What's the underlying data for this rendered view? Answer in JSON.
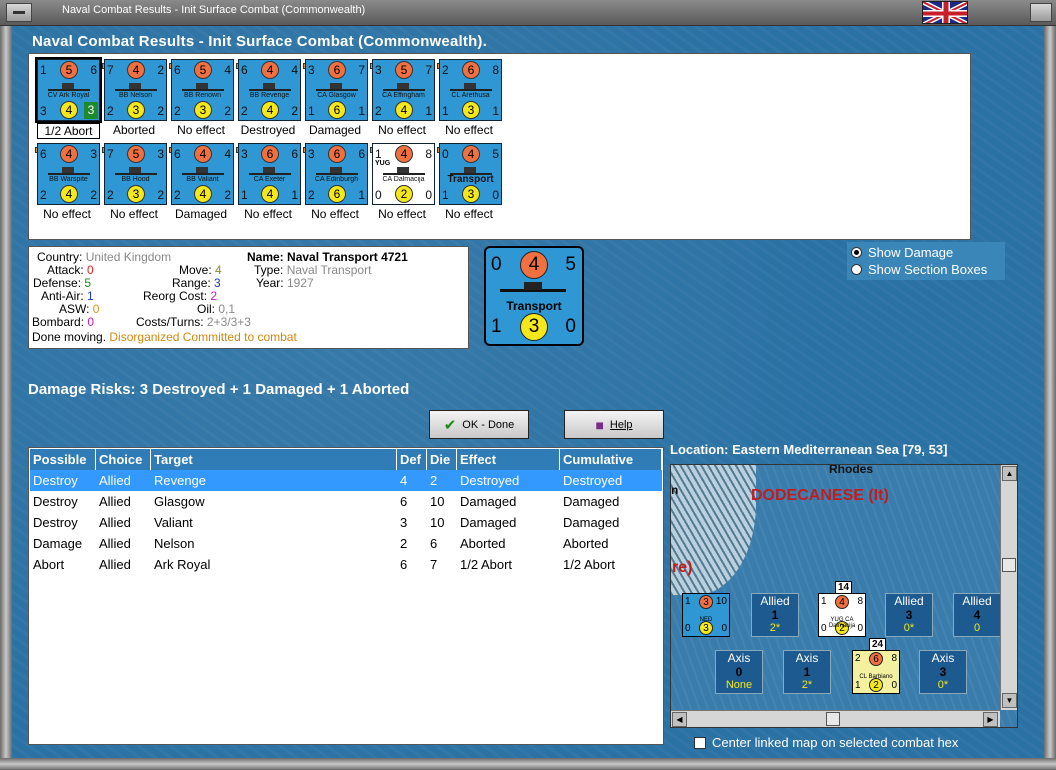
{
  "window": {
    "title": "Naval Combat Results - Init Surface Combat (Commonwealth)"
  },
  "heading": "Naval Combat Results - Init Surface Combat (Commonwealth).",
  "units": [
    {
      "tl": "1",
      "tc": "5",
      "tr": "6",
      "bl": "3",
      "bc": "4",
      "br": "3",
      "name": "CV Ark Royal",
      "result": "1/2 Abort",
      "selected": true,
      "green": true
    },
    {
      "tl": "7",
      "tc": "4",
      "tr": "2",
      "bl": "2",
      "bc": "3",
      "br": "2",
      "name": "BB Nelson",
      "result": "Aborted"
    },
    {
      "tl": "6",
      "tc": "5",
      "tr": "4",
      "bl": "2",
      "bc": "3",
      "br": "2",
      "name": "BB Renown",
      "result": "No effect"
    },
    {
      "tl": "6",
      "tc": "4",
      "tr": "4",
      "bl": "2",
      "bc": "4",
      "br": "2",
      "name": "BB Revenge",
      "result": "Destroyed"
    },
    {
      "tl": "3",
      "tc": "6",
      "tr": "7",
      "bl": "1",
      "bc": "6",
      "br": "1",
      "name": "CA Glasgow",
      "result": "Damaged"
    },
    {
      "tl": "3",
      "tc": "5",
      "tr": "7",
      "bl": "2",
      "bc": "4",
      "br": "1",
      "name": "CA Effingham",
      "result": "No effect"
    },
    {
      "tl": "2",
      "tc": "6",
      "tr": "8",
      "bl": "1",
      "bc": "3",
      "br": "1",
      "name": "CL Arethusa",
      "result": "No effect"
    },
    {
      "tl": "6",
      "tc": "4",
      "tr": "3",
      "bl": "2",
      "bc": "4",
      "br": "2",
      "name": "BB Warspite",
      "result": "No effect"
    },
    {
      "tl": "7",
      "tc": "5",
      "tr": "3",
      "bl": "2",
      "bc": "3",
      "br": "2",
      "name": "BB Hood",
      "result": "No effect"
    },
    {
      "tl": "6",
      "tc": "4",
      "tr": "4",
      "bl": "2",
      "bc": "4",
      "br": "2",
      "name": "BB Valiant",
      "result": "Damaged"
    },
    {
      "tl": "3",
      "tc": "6",
      "tr": "6",
      "bl": "1",
      "bc": "4",
      "br": "1",
      "name": "CA Exeter",
      "result": "No effect"
    },
    {
      "tl": "3",
      "tc": "6",
      "tr": "6",
      "bl": "2",
      "bc": "6",
      "br": "1",
      "name": "CA Edinburgh",
      "result": "No effect"
    },
    {
      "tl": "1",
      "tc": "4",
      "tr": "8",
      "bl": "0",
      "bc": "2",
      "br": "0",
      "name": "CA Dalmacija",
      "nat": "YUG",
      "result": "No effect",
      "white": true
    },
    {
      "tl": "0",
      "tc": "4",
      "tr": "5",
      "bl": "1",
      "bc": "3",
      "br": "0",
      "name": "Transport",
      "result": "No effect",
      "big": true
    }
  ],
  "info": {
    "country_label": "Country:",
    "country": "United Kingdom",
    "attack_label": "Attack:",
    "attack": "0",
    "defense_label": "Defense:",
    "defense": "5",
    "antiair_label": "Anti-Air:",
    "antiair": "1",
    "asw_label": "ASW:",
    "asw": "0",
    "bombard_label": "Bombard:",
    "bombard": "0",
    "name_label": "Name:",
    "name": "Naval Transport 4721",
    "type_label": "Type:",
    "type": "Naval Transport",
    "year_label": "Year:",
    "year": "1927",
    "move_label": "Move:",
    "move": "4",
    "range_label": "Range:",
    "range": "3",
    "reorg_label": "Reorg Cost:",
    "reorg": "2",
    "oil_label": "Oil:",
    "oil": "0,1",
    "costs_label": "Costs/Turns:",
    "costs": "2+3/3+3",
    "status_label": "Done moving.",
    "status": "Disorganized Committed to combat"
  },
  "big_counter": {
    "tl": "0",
    "tc": "4",
    "tr": "5",
    "bl": "1",
    "bc": "3",
    "br": "0",
    "name": "Transport"
  },
  "radio": {
    "show_damage": "Show Damage",
    "show_sections": "Show Section Boxes"
  },
  "damage_risks": "Damage Risks: 3 Destroyed + 1 Damaged + 1 Aborted",
  "buttons": {
    "ok": "OK - Done",
    "help": "Help"
  },
  "table": {
    "headers": [
      "Possible",
      "Choice",
      "Target",
      "Def",
      "Die",
      "Effect",
      "Cumulative"
    ],
    "rows": [
      [
        "Destroy",
        "Allied",
        "Revenge",
        "4",
        "2",
        "Destroyed",
        "Destroyed"
      ],
      [
        "Destroy",
        "Allied",
        "Glasgow",
        "6",
        "10",
        "Damaged",
        "Damaged"
      ],
      [
        "Destroy",
        "Allied",
        "Valiant",
        "3",
        "10",
        "Damaged",
        "Damaged"
      ],
      [
        "Damage",
        "Allied",
        "Nelson",
        "2",
        "6",
        "Aborted",
        "Aborted"
      ],
      [
        "Abort",
        "Allied",
        "Ark Royal",
        "6",
        "7",
        "1/2 Abort",
        "1/2 Abort"
      ]
    ]
  },
  "map": {
    "location": "Location:  Eastern Mediterranean Sea [79, 53]",
    "label_rhodes": "Rhodes",
    "label_dodecanese": "DODECANESE (It)",
    "label_re": "re)",
    "label_n": "n",
    "stack1": "14",
    "stack2": "24",
    "allied_boxes": [
      {
        "side": "Allied",
        "val": "1",
        "sub": "2*"
      },
      {
        "side": "Allied",
        "val": "3",
        "sub": "0*"
      },
      {
        "side": "Allied",
        "val": "4",
        "sub": "0"
      }
    ],
    "axis_boxes": [
      {
        "side": "Axis",
        "val": "0",
        "sub": "None"
      },
      {
        "side": "Axis",
        "val": "1",
        "sub": "2*"
      },
      {
        "side": "Axis",
        "val": "3",
        "sub": "0*"
      }
    ],
    "counters": [
      {
        "a": "1",
        "tc": "3",
        "b": "10",
        "c": "0",
        "bc": "3",
        "d": "0",
        "name": "NED"
      },
      {
        "a": "1",
        "tc": "4",
        "b": "8",
        "c": "0",
        "bc": "2",
        "d": "0",
        "name": "CA Dalmacija",
        "nat": "YUG"
      },
      {
        "a": "2",
        "tc": "6",
        "b": "8",
        "c": "1",
        "bc": "2",
        "d": "0",
        "name": "CL Barbiano"
      }
    ],
    "center_linked": "Center linked map on selected combat hex"
  },
  "colors": {
    "attack": "#e02020",
    "defense": "#1a8a1a",
    "antiair": "#1a3ad8",
    "asw": "#e09020",
    "bombard": "#c020c0",
    "move": "#8a8a20",
    "range": "#1a3ad8",
    "reorg": "#c020c0",
    "status": "#d08a10"
  }
}
